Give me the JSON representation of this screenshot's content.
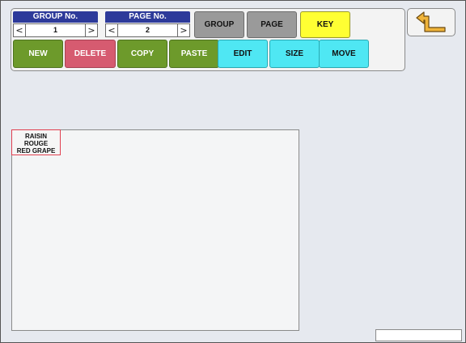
{
  "group": {
    "header": "GROUP No.",
    "value": "1",
    "prev": "<",
    "next": ">"
  },
  "page": {
    "header": "PAGE No.",
    "value": "2",
    "prev": "<",
    "next": ">"
  },
  "mode_buttons": {
    "group": "GROUP",
    "page": "PAGE",
    "key": "KEY"
  },
  "action_buttons": {
    "new": "NEW",
    "delete": "DELETE",
    "copy": "COPY",
    "paste": "PASTE",
    "edit": "EDIT",
    "size": "SIZE",
    "move": "MOVE"
  },
  "back_icon": "return-arrow-icon",
  "key_item": {
    "line1": "RAISIN",
    "line2": "ROUGE",
    "line3": "RED GRAPE"
  },
  "colors": {
    "header_blue": "#2d3a9a",
    "mode_gray": "#9a9a9a",
    "key_yellow": "#ffff33",
    "action_green": "#6d9a2b",
    "delete_red": "#d65b70",
    "edit_cyan": "#4fe7f3",
    "arrow_gold": "#f0b43a"
  }
}
